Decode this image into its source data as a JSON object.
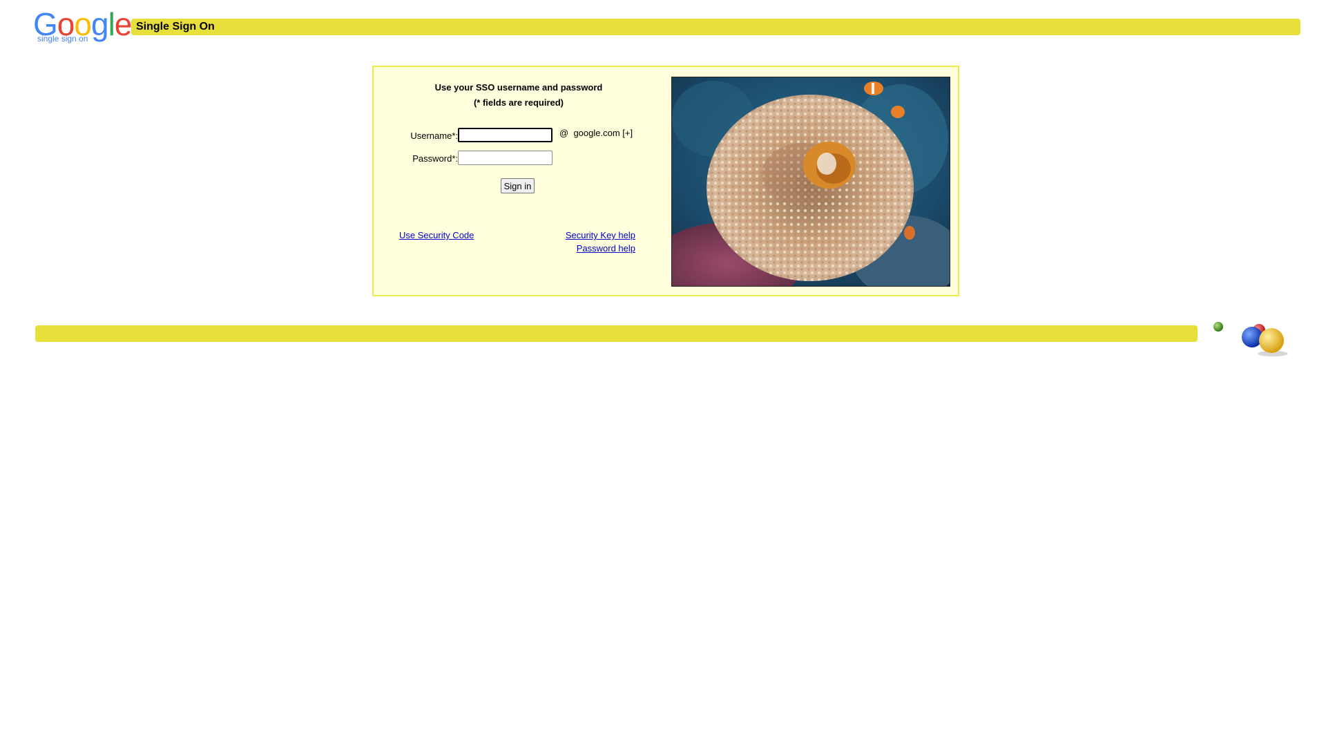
{
  "header": {
    "logo_letters": [
      "G",
      "o",
      "o",
      "g",
      "l",
      "e"
    ],
    "logo_colors": [
      "#4285f4",
      "#ea4335",
      "#fbbc05",
      "#4285f4",
      "#34a853",
      "#ea4335"
    ],
    "logo_subtitle": "single sign on",
    "title": "Single Sign On",
    "bar_color": "#e8e03a"
  },
  "login": {
    "heading_line1": "Use your SSO username and password",
    "heading_line2": "(* fields are required)",
    "username_label": "Username*:",
    "username_value": "",
    "password_label": "Password*:",
    "password_value": "",
    "domain_at": "@",
    "domain_text": "google.com [+]",
    "signin_label": "Sign in",
    "panel_bg": "#ffffdd",
    "panel_border": "#ecec4a"
  },
  "links": {
    "security_code": "Use Security Code",
    "security_key_help": "Security Key help",
    "password_help": "Password help"
  },
  "photo": {
    "icon": "sea-anemone-clownfish-photo"
  },
  "footer": {
    "bar_color": "#e8e03a",
    "icon": "google-balls-icon"
  }
}
